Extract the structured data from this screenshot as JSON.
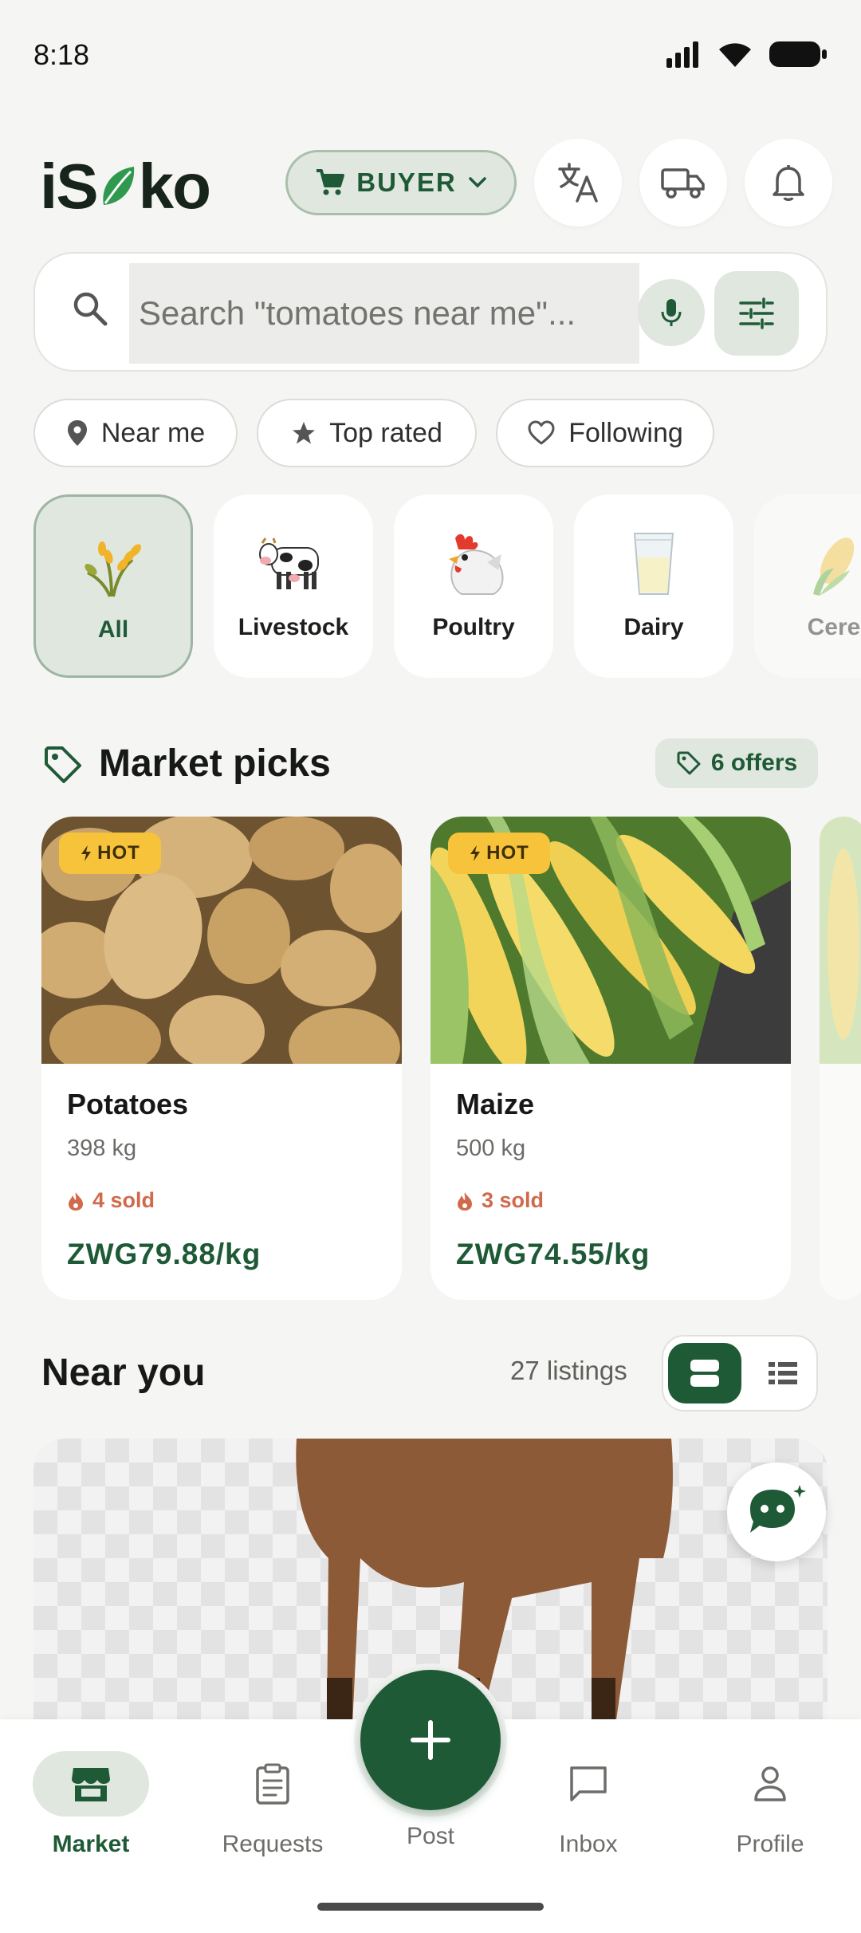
{
  "status_bar": {
    "time": "8:18"
  },
  "header": {
    "logo_text_left": "iS",
    "logo_text_right": "ko",
    "role_label": "BUYER",
    "icons": [
      "translate-icon",
      "truck-icon",
      "bell-icon"
    ]
  },
  "search": {
    "placeholder": "Search \"tomatoes near me\"..."
  },
  "chips": [
    {
      "label": "Near me",
      "icon": "location-pin-icon"
    },
    {
      "label": "Top rated",
      "icon": "star-icon"
    },
    {
      "label": "Following",
      "icon": "heart-icon"
    }
  ],
  "categories": [
    {
      "label": "All",
      "icon": "wheat-icon",
      "active": true
    },
    {
      "label": "Livestock",
      "icon": "cow-icon"
    },
    {
      "label": "Poultry",
      "icon": "rooster-icon"
    },
    {
      "label": "Dairy",
      "icon": "milk-glass-icon"
    },
    {
      "label": "Cere",
      "icon": "corn-icon"
    }
  ],
  "market_picks": {
    "title": "Market picks",
    "offers_label": "6 offers",
    "products": [
      {
        "badge": "HOT",
        "name": "Potatoes",
        "qty": "398 kg",
        "sold": "4 sold",
        "price": "ZWG79.88/kg"
      },
      {
        "badge": "HOT",
        "name": "Maize",
        "qty": "500 kg",
        "sold": "3 sold",
        "price": "ZWG74.55/kg"
      }
    ]
  },
  "near_you": {
    "title": "Near you",
    "count_label": "27 listings"
  },
  "bottom_nav": {
    "items": [
      {
        "label": "Market",
        "icon": "store-icon",
        "active": true
      },
      {
        "label": "Requests",
        "icon": "clipboard-icon"
      },
      {
        "label": "Post",
        "icon": "plus-icon"
      },
      {
        "label": "Inbox",
        "icon": "chat-icon"
      },
      {
        "label": "Profile",
        "icon": "person-icon"
      }
    ]
  },
  "colors": {
    "brand_green": "#1f5a37",
    "brand_green_light": "#dfe7df",
    "hot_badge": "#f6c33a",
    "sold_text": "#d06a4b",
    "background": "#f5f5f3"
  }
}
